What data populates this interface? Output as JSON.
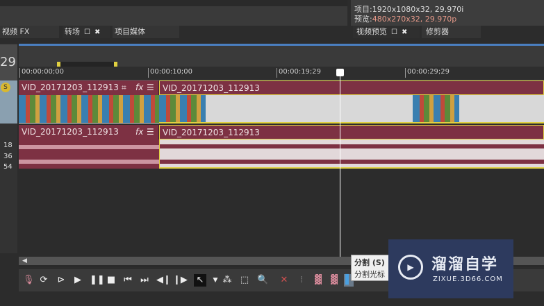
{
  "panels": {
    "tabs_left": [
      {
        "label": "视频 FX"
      },
      {
        "label": "转场"
      },
      {
        "label": "项目媒体"
      }
    ],
    "tabs_right": [
      {
        "label": "视频预览"
      },
      {
        "label": "修剪器"
      }
    ]
  },
  "preview_info": {
    "project_label": "项目:",
    "project_value": "1920x1080x32, 29.970i",
    "preview_label": "预览:",
    "preview_value": "480x270x32, 29.970p",
    "preview_color": "#e79a8a"
  },
  "timecode_fragment": "29",
  "ruler": [
    "00:00:00;00",
    "00:00:10;00",
    "00:00:19;29",
    "00:00:29;29"
  ],
  "tracks": {
    "video": {
      "clips": [
        {
          "name": "VID_20171203_112913"
        },
        {
          "name": "VID_20171203_112913"
        }
      ]
    },
    "audio": {
      "clips": [
        {
          "name": "VID_20171203_112913"
        },
        {
          "name": "VID_20171203_112913"
        }
      ],
      "levels": [
        "18",
        "36",
        "54"
      ]
    }
  },
  "tooltip": {
    "title": "分割 (S)",
    "desc": "分割光标"
  },
  "watermark": {
    "title": "溜溜自学",
    "url": "ZIXUE.3D66.COM"
  },
  "colors": {
    "clip": "#7d3143",
    "accent": "#4a7fc1",
    "selection": "#e0d040"
  }
}
